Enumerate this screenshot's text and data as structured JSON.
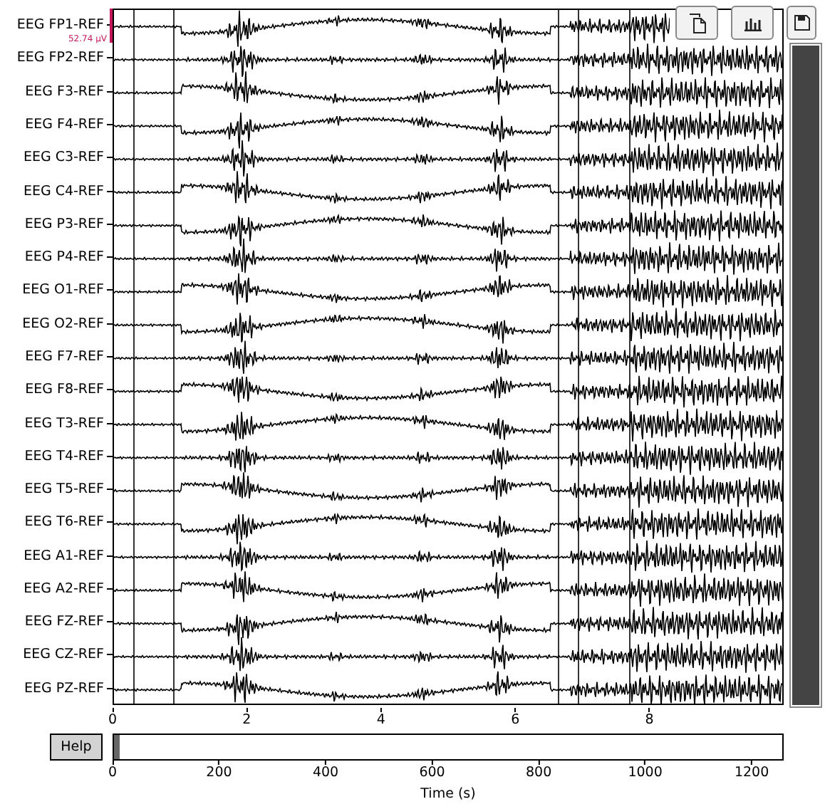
{
  "channels": [
    "EEG FP1-REF",
    "EEG FP2-REF",
    "EEG F3-REF",
    "EEG F4-REF",
    "EEG C3-REF",
    "EEG C4-REF",
    "EEG P3-REF",
    "EEG P4-REF",
    "EEG O1-REF",
    "EEG O2-REF",
    "EEG F7-REF",
    "EEG F8-REF",
    "EEG T3-REF",
    "EEG T4-REF",
    "EEG T5-REF",
    "EEG T6-REF",
    "EEG A1-REF",
    "EEG A2-REF",
    "EEG FZ-REF",
    "EEG CZ-REF",
    "EEG PZ-REF"
  ],
  "scale_bar": {
    "label": "52.74 µV"
  },
  "x_axis": {
    "ticks": [
      "0",
      "2",
      "4",
      "6",
      "8"
    ]
  },
  "toolbar": [
    {
      "kind": "projectors"
    },
    {
      "kind": "psd"
    },
    {
      "kind": "save"
    }
  ],
  "help_button": {
    "label": "Help"
  },
  "overview": {
    "ticks": [
      "0",
      "200",
      "400",
      "600",
      "800",
      "1000",
      "1200"
    ],
    "xlabel": "Time (s)"
  }
}
